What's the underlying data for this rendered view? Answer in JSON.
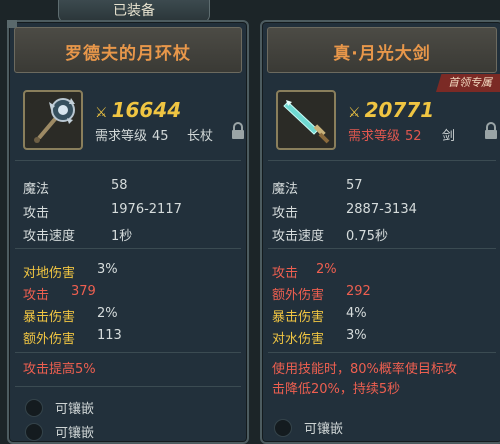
{
  "tab": {
    "label": "已装备"
  },
  "left": {
    "name": "罗德夫的月环杖",
    "power_icon": "crossed-weapons-icon",
    "power": "16644",
    "req_label": "需求等级",
    "req_level": "45",
    "weapon_type": "长杖",
    "stats": [
      {
        "key": "魔法",
        "val": "58"
      },
      {
        "key": "攻击",
        "val": "1976-2117"
      },
      {
        "key": "攻击速度",
        "val": "1秒"
      }
    ],
    "bonus": [
      {
        "key": "对地伤害",
        "val": "3%"
      },
      {
        "key": "攻击",
        "val": "379"
      },
      {
        "key": "暴击伤害",
        "val": "2%"
      },
      {
        "key": "额外伤害",
        "val": "113"
      }
    ],
    "effect": "攻击提高5%",
    "sockets": [
      "可镶嵌",
      "可镶嵌"
    ]
  },
  "right": {
    "name": "真·月光大剑",
    "badge": "首领专属",
    "power_icon": "crossed-weapons-icon",
    "power": "20771",
    "req_label": "需求等级",
    "req_level": "52",
    "weapon_type": "剑",
    "stats": [
      {
        "key": "魔法",
        "val": "57"
      },
      {
        "key": "攻击",
        "val": "2887-3134"
      },
      {
        "key": "攻击速度",
        "val": "0.75秒"
      }
    ],
    "bonus": [
      {
        "key": "攻击",
        "val": "2%"
      },
      {
        "key": "额外伤害",
        "val": "292"
      },
      {
        "key": "暴击伤害",
        "val": "4%"
      },
      {
        "key": "对水伤害",
        "val": "3%"
      }
    ],
    "effect_line1": "使用技能时，80%概率使目标攻",
    "effect_line2": "击降低20%，持续5秒",
    "sockets": [
      "可镶嵌"
    ]
  },
  "colors": {
    "title": "#e8974a",
    "power": "#f0c542",
    "warning": "#ee5f50",
    "panel": "#22303b"
  }
}
